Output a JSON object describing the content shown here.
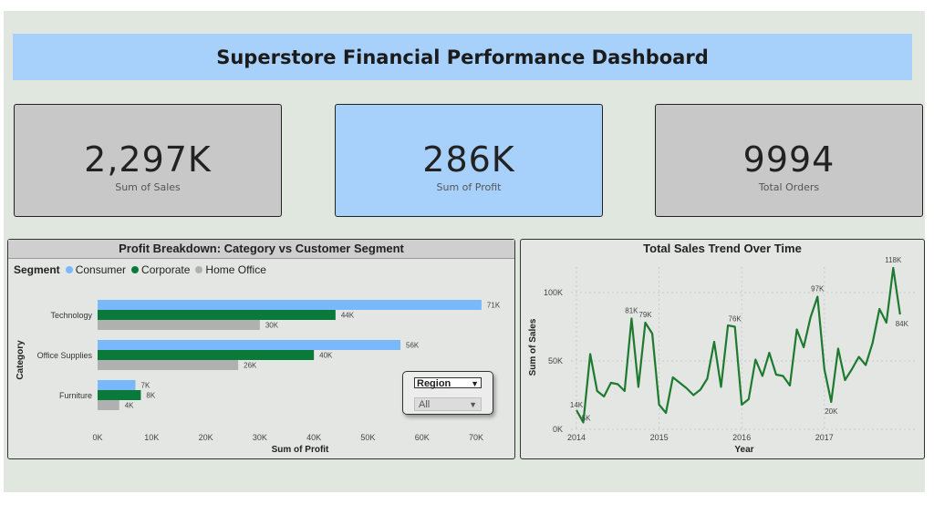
{
  "header": {
    "title": "Superstore Financial Performance Dashboard"
  },
  "kpis": [
    {
      "value": "2,297K",
      "label": "Sum of Sales",
      "bg": "#c8c8c8"
    },
    {
      "value": "286K",
      "label": "Sum of Profit",
      "bg": "#a7d1fb"
    },
    {
      "value": "9994",
      "label": "Total Orders",
      "bg": "#c8c8c8"
    }
  ],
  "colors": {
    "consumer": "#79b9fb",
    "corporate": "#0a7a3a",
    "home_office": "#b0b0b0",
    "trend_line": "#1d7a2f"
  },
  "profit_panel": {
    "title": "Profit Breakdown: Category vs Customer Segment",
    "legend_title": "Segment",
    "legend": [
      "Consumer",
      "Corporate",
      "Home Office"
    ],
    "slicer": {
      "title": "Region",
      "value": "All"
    }
  },
  "trend_panel": {
    "title": "Total Sales Trend Over Time"
  },
  "chart_data": [
    {
      "type": "bar",
      "orientation": "horizontal",
      "title": "Profit Breakdown: Category vs Customer Segment",
      "xlabel": "Sum of Profit",
      "ylabel": "Category",
      "categories": [
        "Technology",
        "Office Supplies",
        "Furniture"
      ],
      "series": [
        {
          "name": "Consumer",
          "values": [
            71000,
            56000,
            7000
          ],
          "labels": [
            "71K",
            "56K",
            "7K"
          ]
        },
        {
          "name": "Corporate",
          "values": [
            44000,
            40000,
            8000
          ],
          "labels": [
            "44K",
            "40K",
            "8K"
          ]
        },
        {
          "name": "Home Office",
          "values": [
            30000,
            26000,
            4000
          ],
          "labels": [
            "30K",
            "26K",
            "4K"
          ]
        }
      ],
      "xlim": [
        0,
        70000
      ],
      "xticks": [
        "0K",
        "10K",
        "20K",
        "30K",
        "40K",
        "50K",
        "60K",
        "70K"
      ],
      "legend_position": "top-left",
      "grid": false
    },
    {
      "type": "line",
      "title": "Total Sales Trend Over Time",
      "xlabel": "Year",
      "ylabel": "Sum of Sales",
      "x_start": "2014-01",
      "x_step": "month",
      "xticks": [
        "2014",
        "2015",
        "2016",
        "2017"
      ],
      "yticks": [
        "0K",
        "50K",
        "100K"
      ],
      "ylim": [
        0,
        120000
      ],
      "series": [
        {
          "name": "Sum of Sales",
          "values": [
            14000,
            5000,
            55000,
            28000,
            24000,
            34000,
            33000,
            28000,
            81000,
            31000,
            78000,
            70000,
            18000,
            12000,
            38000,
            34000,
            30000,
            25000,
            29000,
            37000,
            64000,
            31000,
            76000,
            75000,
            18000,
            22000,
            51000,
            39000,
            56000,
            40000,
            39000,
            32000,
            73000,
            60000,
            82000,
            97000,
            44000,
            20000,
            59000,
            36000,
            44000,
            53000,
            47000,
            63000,
            88000,
            78000,
            118000,
            84000
          ]
        }
      ],
      "point_labels": [
        {
          "index": 0,
          "text": "14K"
        },
        {
          "index": 1,
          "text": "5K"
        },
        {
          "index": 8,
          "text": "81K"
        },
        {
          "index": 10,
          "text": "79K"
        },
        {
          "index": 23,
          "text": "76K"
        },
        {
          "index": 35,
          "text": "97K"
        },
        {
          "index": 37,
          "text": "20K"
        },
        {
          "index": 46,
          "text": "118K"
        },
        {
          "index": 47,
          "text": "84K"
        }
      ],
      "grid": true
    }
  ]
}
